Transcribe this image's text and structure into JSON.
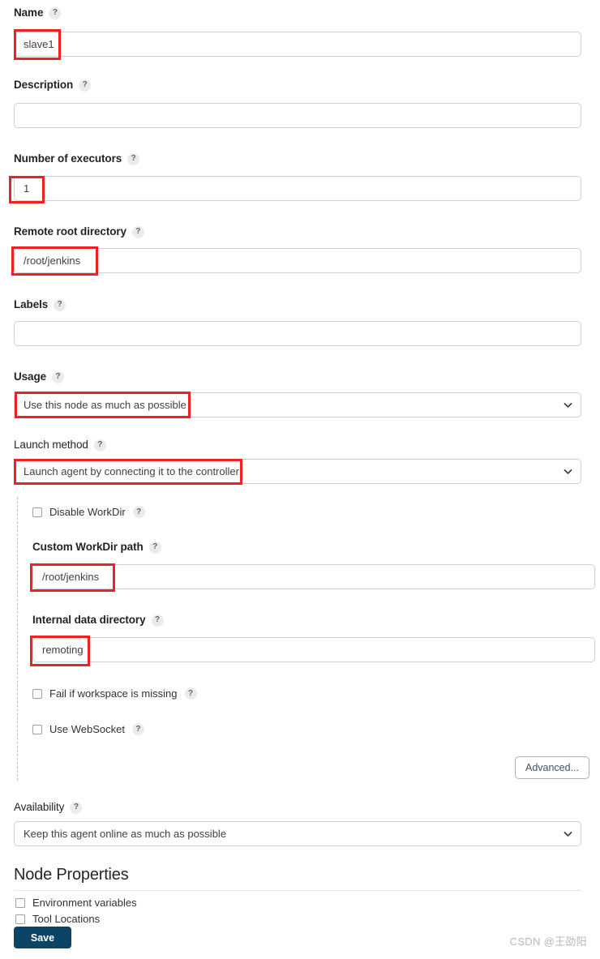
{
  "form": {
    "fields": [
      {
        "label": "Name",
        "help": "?",
        "type": "text",
        "value": "slave1",
        "placeholder": ""
      },
      {
        "label": "Description",
        "help": "?",
        "type": "text",
        "value": "",
        "placeholder": ""
      },
      {
        "label": "Number of executors",
        "help": "?",
        "type": "text",
        "value": "1",
        "placeholder": ""
      },
      {
        "label": "Remote root directory",
        "help": "?",
        "type": "text",
        "value": "/root/jenkins",
        "placeholder": ""
      },
      {
        "label": "Labels",
        "help": "?",
        "type": "text",
        "value": "",
        "placeholder": ""
      },
      {
        "label": "Usage",
        "help": "?",
        "type": "select",
        "value": "Use this node as much as possible"
      },
      {
        "label": "Launch method",
        "help": "?",
        "type": "select",
        "value": "Launch agent by connecting it to the controller"
      }
    ],
    "launch_panel": {
      "disable_workdir": {
        "label": "Disable WorkDir",
        "help": "?",
        "checked": false
      },
      "custom_workdir": {
        "label": "Custom WorkDir path",
        "help": "?",
        "value": "/root/jenkins"
      },
      "internal_data_dir": {
        "label": "Internal data directory",
        "help": "?",
        "value": "remoting"
      },
      "fail_if_missing": {
        "label": "Fail if workspace is missing",
        "help": "?",
        "checked": false
      },
      "use_websocket": {
        "label": "Use WebSocket",
        "help": "?",
        "checked": false
      },
      "advanced_label": "Advanced..."
    },
    "availability": {
      "label": "Availability",
      "help": "?",
      "value": "Keep this agent online as much as possible"
    },
    "node_properties": {
      "heading": "Node Properties",
      "items": [
        {
          "label": "Environment variables",
          "checked": false
        },
        {
          "label": "Tool Locations",
          "checked": false
        }
      ]
    },
    "save_label": "Save"
  },
  "watermark": "CSDN @王劭阳",
  "colors": {
    "accent": "#0b4566",
    "annotation": "#ee2222",
    "input_border": "#c9d1d9",
    "help_bg": "#ebebeb"
  }
}
